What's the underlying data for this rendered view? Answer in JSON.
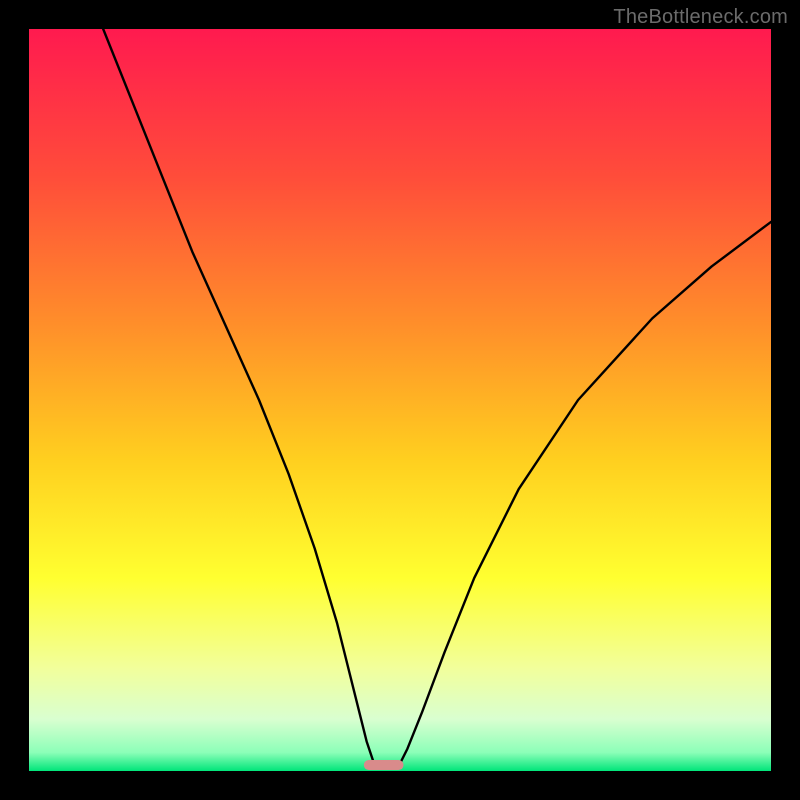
{
  "watermark": "TheBottleneck.com",
  "chart_data": {
    "type": "line",
    "title": "",
    "xlabel": "",
    "ylabel": "",
    "xlim": [
      0,
      100
    ],
    "ylim": [
      0,
      100
    ],
    "grid": false,
    "legend": false,
    "background_gradient": {
      "stops": [
        {
          "offset": 0.0,
          "color": "#ff1a4f"
        },
        {
          "offset": 0.2,
          "color": "#ff4d3a"
        },
        {
          "offset": 0.4,
          "color": "#ff8f2a"
        },
        {
          "offset": 0.58,
          "color": "#ffcf1f"
        },
        {
          "offset": 0.74,
          "color": "#ffff30"
        },
        {
          "offset": 0.86,
          "color": "#f2ff9a"
        },
        {
          "offset": 0.93,
          "color": "#d9ffd0"
        },
        {
          "offset": 0.975,
          "color": "#8cffb8"
        },
        {
          "offset": 1.0,
          "color": "#00e57a"
        }
      ]
    },
    "curve_points_xy": [
      [
        10.0,
        100.0
      ],
      [
        14.0,
        90.0
      ],
      [
        18.0,
        80.0
      ],
      [
        22.0,
        70.0
      ],
      [
        26.5,
        60.0
      ],
      [
        31.0,
        50.0
      ],
      [
        35.0,
        40.0
      ],
      [
        38.5,
        30.0
      ],
      [
        41.5,
        20.0
      ],
      [
        44.0,
        10.0
      ],
      [
        45.5,
        4.0
      ],
      [
        46.5,
        1.0
      ],
      [
        47.5,
        0.3
      ],
      [
        49.0,
        0.3
      ],
      [
        50.0,
        1.0
      ],
      [
        51.0,
        3.0
      ],
      [
        53.0,
        8.0
      ],
      [
        56.0,
        16.0
      ],
      [
        60.0,
        26.0
      ],
      [
        66.0,
        38.0
      ],
      [
        74.0,
        50.0
      ],
      [
        84.0,
        61.0
      ],
      [
        92.0,
        68.0
      ],
      [
        100.0,
        74.0
      ]
    ],
    "marker_segment_xy": [
      [
        45.8,
        0.8
      ],
      [
        49.8,
        0.8
      ]
    ],
    "marker_color": "#d98b8b",
    "curve_color": "#000000",
    "curve_width": 2.4
  }
}
